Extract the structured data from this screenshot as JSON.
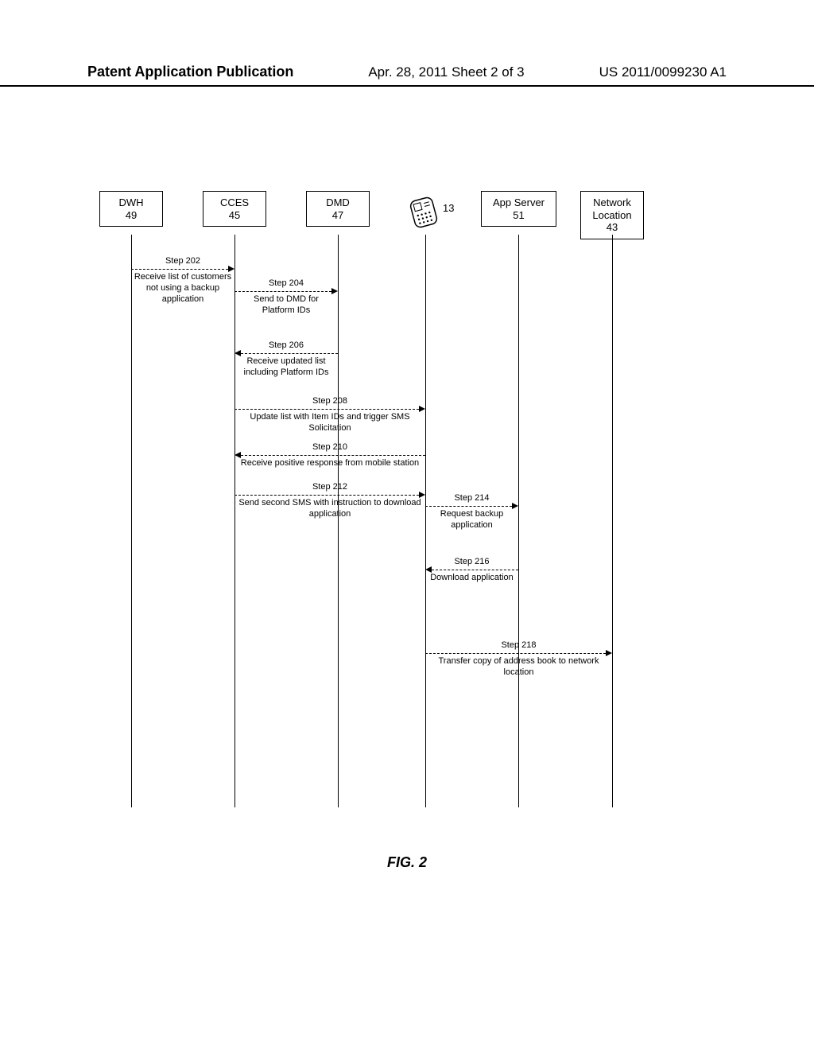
{
  "header": {
    "left": "Patent Application Publication",
    "center": "Apr. 28, 2011  Sheet 2 of 3",
    "right": "US 2011/0099230 A1"
  },
  "actors": {
    "dwh": {
      "line1": "DWH",
      "line2": "49"
    },
    "cces": {
      "line1": "CCES",
      "line2": "45"
    },
    "dmd": {
      "line1": "DMD",
      "line2": "47"
    },
    "phone": {
      "label": "13"
    },
    "appserver": {
      "line1": "App Server",
      "line2": "51"
    },
    "netloc": {
      "line1": "Network",
      "line2": "Location",
      "line3": "43"
    }
  },
  "steps": {
    "s202": {
      "title": "Step 202",
      "desc": "Receive list of customers\nnot using a backup\napplication"
    },
    "s204": {
      "title": "Step 204",
      "desc": "Send to DMD for\nPlatform IDs"
    },
    "s206": {
      "title": "Step 206",
      "desc": "Receive updated list\nincluding Platform IDs"
    },
    "s208": {
      "title": "Step 208",
      "desc": "Update list with Item IDs and trigger SMS\nSolicitation"
    },
    "s210": {
      "title": "Step 210",
      "desc": "Receive positive response from mobile station"
    },
    "s212": {
      "title": "Step 212",
      "desc": "Send second SMS with instruction to download\napplication"
    },
    "s214": {
      "title": "Step 214",
      "desc": "Request backup\napplication"
    },
    "s216": {
      "title": "Step 216",
      "desc": "Download application"
    },
    "s218": {
      "title": "Step 218",
      "desc": "Transfer copy of address book to network\nlocation"
    }
  },
  "caption": "FIG. 2"
}
